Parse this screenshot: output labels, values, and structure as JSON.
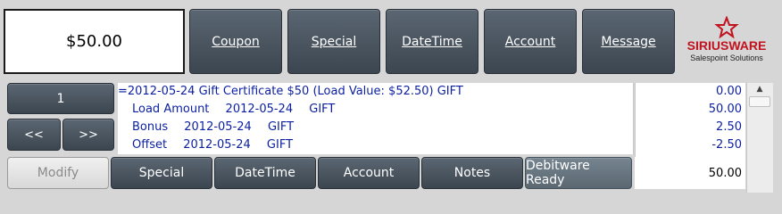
{
  "amount_display": "$50.00",
  "top_buttons": [
    "Coupon",
    "Special",
    "DateTime",
    "Account",
    "Message"
  ],
  "logo": {
    "brand": "SIRIUSWARE",
    "tagline": "Salespoint Solutions"
  },
  "counter": "1",
  "nav": {
    "prev": "<<",
    "next": ">>"
  },
  "items": [
    {
      "text": "=2012-05-24 Gift Certificate $50  (Load Value: $52.50) GIFT"
    },
    {
      "label": "Load Amount",
      "date": "2012-05-24",
      "type": "GIFT"
    },
    {
      "label": "Bonus",
      "date": "2012-05-24",
      "type": "GIFT"
    },
    {
      "label": "Offset",
      "date": "2012-05-24",
      "type": "GIFT"
    }
  ],
  "amounts": [
    "0.00",
    "50.00",
    "2.50",
    "-2.50"
  ],
  "total": "50.00",
  "bottom_buttons": [
    "Modify",
    "Special",
    "DateTime",
    "Account",
    "Notes",
    "Debitware Ready"
  ],
  "colors": {
    "accent_red": "#c1121f",
    "item_text": "#0b1fa0",
    "button_dark": "#4a5560"
  }
}
